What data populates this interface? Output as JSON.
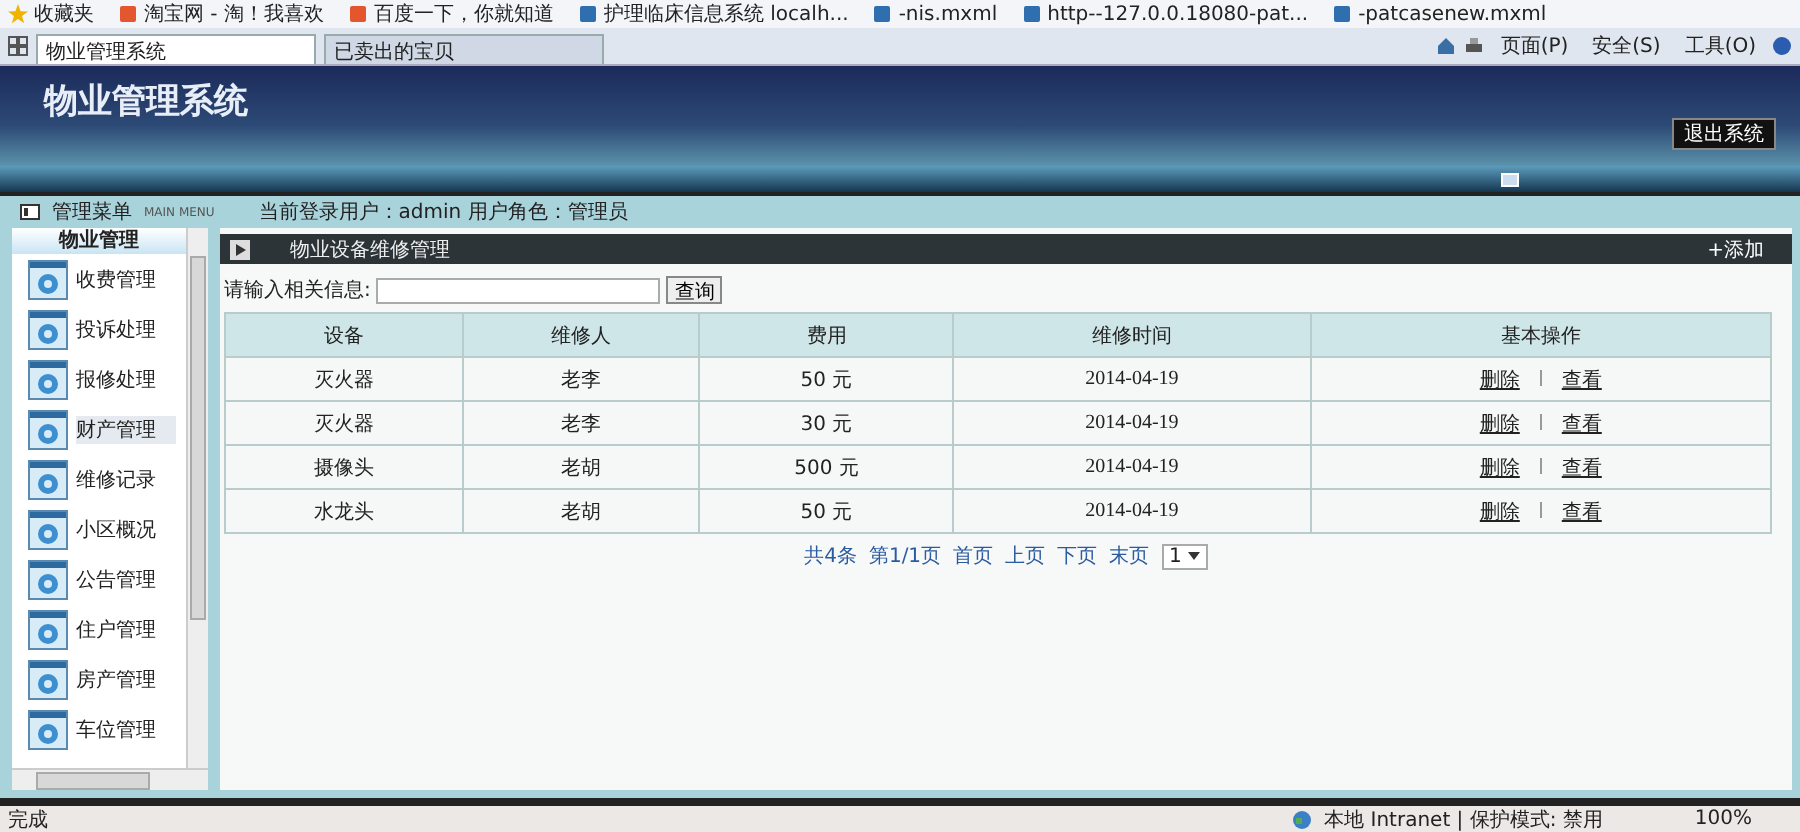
{
  "browser": {
    "favorites_label": "收藏夹",
    "favorites": [
      "淘宝网 - 淘！我喜欢",
      "百度一下，你就知道",
      "护理临床信息系统 localh...",
      "-nis.mxml",
      "http--127.0.0.18080-pat...",
      "-patcasenew.mxml"
    ],
    "tabs": [
      {
        "label": "物业管理系统",
        "selected": true
      },
      {
        "label": "已卖出的宝贝",
        "selected": false
      }
    ],
    "tools": [
      "页面(P)",
      "安全(S)",
      "工具(O)"
    ]
  },
  "header": {
    "title": "物业管理系统",
    "logout": "退出系统"
  },
  "info_bar": {
    "menu_title": "管理菜单",
    "menu_subtitle": "MAIN MENU",
    "user": "当前登录用户：admin 用户角色：管理员"
  },
  "sidebar": {
    "heading": "物业管理",
    "items": [
      {
        "label": "收费管理",
        "selected": false
      },
      {
        "label": "投诉处理",
        "selected": false
      },
      {
        "label": "报修处理",
        "selected": false
      },
      {
        "label": "财产管理",
        "selected": true
      },
      {
        "label": "维修记录",
        "selected": false
      },
      {
        "label": "小区概况",
        "selected": false
      },
      {
        "label": "公告管理",
        "selected": false
      },
      {
        "label": "住户管理",
        "selected": false
      },
      {
        "label": "房产管理",
        "selected": false
      },
      {
        "label": "车位管理",
        "selected": false
      }
    ]
  },
  "content": {
    "title": "物业设备维修管理",
    "add": "+添加",
    "search": {
      "label": "请输入相关信息:",
      "button": "查询"
    },
    "table": {
      "columns": [
        "设备",
        "维修人",
        "费用",
        "维修时间",
        "基本操作"
      ],
      "rows": [
        {
          "cells": [
            "灭火器",
            "老李",
            "50 元",
            "2014-04-19"
          ],
          "actions": [
            "删除",
            "查看"
          ]
        },
        {
          "cells": [
            "灭火器",
            "老李",
            "30 元",
            "2014-04-19"
          ],
          "actions": [
            "删除",
            "查看"
          ]
        },
        {
          "cells": [
            "摄像头",
            "老胡",
            "500 元",
            "2014-04-19"
          ],
          "actions": [
            "删除",
            "查看"
          ]
        },
        {
          "cells": [
            "水龙头",
            "老胡",
            "50 元",
            "2014-04-19"
          ],
          "actions": [
            "删除",
            "查看"
          ]
        }
      ]
    },
    "pager": {
      "links": [
        "共4条",
        "第1/1页",
        "首页",
        "上页",
        "下页",
        "末页"
      ],
      "page": "1"
    }
  },
  "status_bar": {
    "text": "完成",
    "zone": "本地 Intranet | 保护模式: 禁用",
    "zoom": "100%"
  }
}
